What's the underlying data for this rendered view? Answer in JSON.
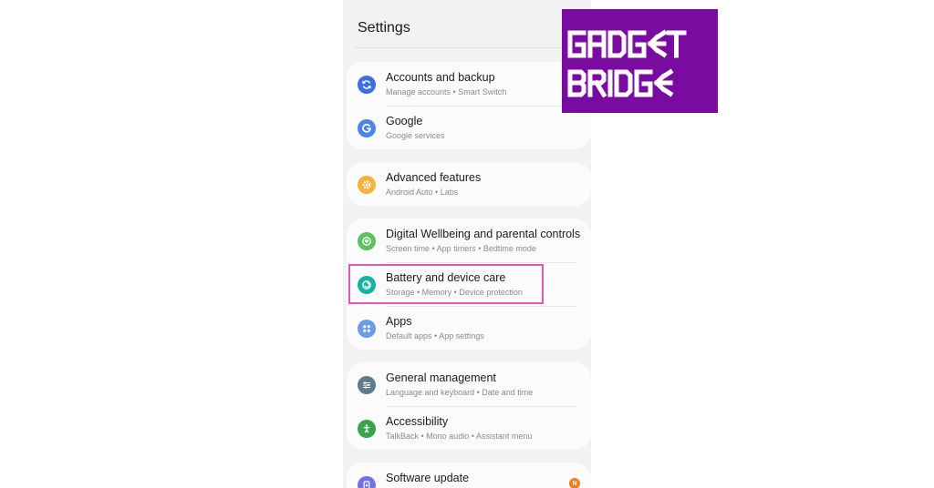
{
  "screen": {
    "title": "Settings"
  },
  "groups": [
    {
      "items": [
        {
          "title": "Accounts and backup",
          "subtitle": "Manage accounts  •  Smart Switch",
          "icon": "sync-icon",
          "color": "#3d6fe0"
        },
        {
          "title": "Google",
          "subtitle": "Google services",
          "icon": "google-g-icon",
          "color": "#4a86e8"
        }
      ]
    },
    {
      "items": [
        {
          "title": "Advanced features",
          "subtitle": "Android Auto  •  Labs",
          "icon": "gear-icon",
          "color": "#f4b340"
        }
      ]
    },
    {
      "items": [
        {
          "title": "Digital Wellbeing and parental controls",
          "subtitle": "Screen time  •  App timers  •  Bedtime mode",
          "icon": "heart-circle-icon",
          "color": "#5cc15e"
        },
        {
          "title": "Battery and device care",
          "subtitle": "Storage  •  Memory  •  Device protection",
          "icon": "device-care-icon",
          "color": "#16b3a0"
        },
        {
          "title": "Apps",
          "subtitle": "Default apps  •  App settings",
          "icon": "apps-grid-icon",
          "color": "#6a9ae8"
        }
      ]
    },
    {
      "items": [
        {
          "title": "General management",
          "subtitle": "Language and keyboard  •  Date and time",
          "icon": "sliders-icon",
          "color": "#5f7c8e"
        },
        {
          "title": "Accessibility",
          "subtitle": "TalkBack  •  Mono audio  •  Assistant menu",
          "icon": "accessibility-icon",
          "color": "#3ba34b"
        }
      ]
    },
    {
      "items": [
        {
          "title": "Software update",
          "subtitle": "",
          "icon": "update-icon",
          "color": "#7173e3",
          "badge": "N"
        }
      ]
    }
  ],
  "highlight_color": "#e057b8",
  "logo": {
    "lines": [
      "GADGET",
      "BRIDGE"
    ],
    "background": "#7a0ba1"
  }
}
